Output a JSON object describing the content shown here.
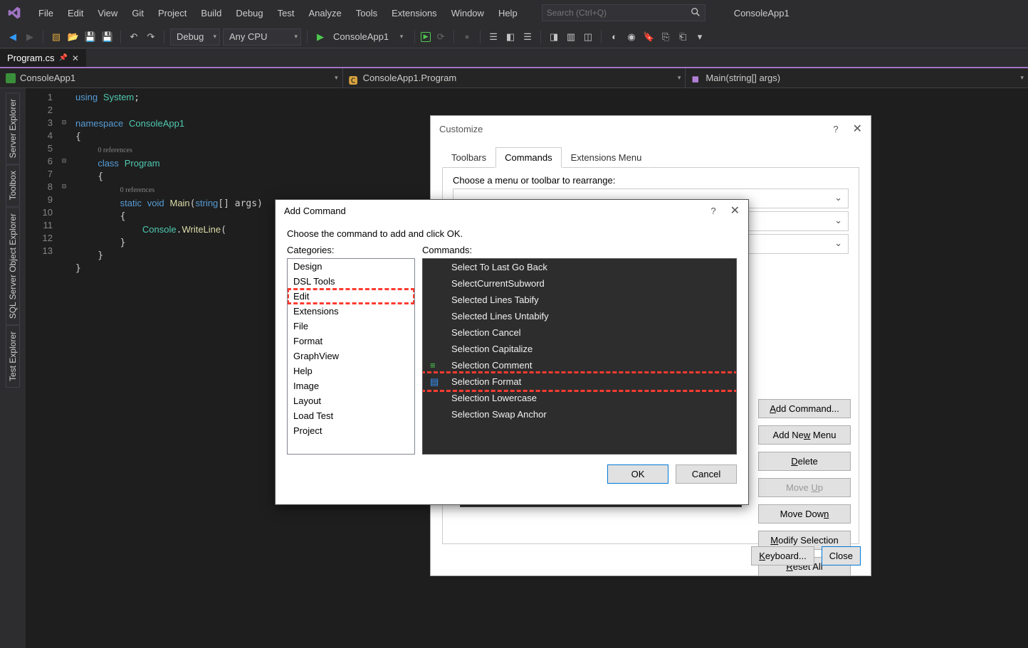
{
  "app": {
    "title": "ConsoleApp1"
  },
  "menu": [
    "File",
    "Edit",
    "View",
    "Git",
    "Project",
    "Build",
    "Debug",
    "Test",
    "Analyze",
    "Tools",
    "Extensions",
    "Window",
    "Help"
  ],
  "search": {
    "placeholder": "Search (Ctrl+Q)"
  },
  "toolbar": {
    "config": "Debug",
    "platform": "Any CPU",
    "target": "ConsoleApp1"
  },
  "tab": {
    "file": "Program.cs"
  },
  "nav": {
    "scope": "ConsoleApp1",
    "class": "ConsoleApp1.Program",
    "member": "Main(string[] args)"
  },
  "side_tabs": [
    "Server Explorer",
    "Toolbox",
    "SQL Server Object Explorer",
    "Test Explorer"
  ],
  "code": {
    "line_numbers": [
      "1",
      "2",
      "3",
      "4",
      "5",
      "6",
      "7",
      "8",
      "9",
      "10",
      "11",
      "12",
      "13"
    ],
    "lens1": "0 references",
    "lens2": "0 references"
  },
  "customize": {
    "title": "Customize",
    "tabs": {
      "toolbars": "Toolbars",
      "commands": "Commands",
      "exts": "Extensions Menu"
    },
    "choose_label": "Choose a menu or toolbar to rearrange:",
    "buttons": {
      "add_cmd": "Add Command...",
      "add_menu": "Add New Menu",
      "delete": "Delete",
      "move_up": "Move Up",
      "move_down": "Move Down",
      "modify": "Modify Selection",
      "reset": "Reset All"
    },
    "bottom": {
      "keyboard": "Keyboard...",
      "close": "Close"
    }
  },
  "addcmd": {
    "title": "Add Command",
    "prompt": "Choose the command to add and click OK.",
    "cat_label": "Categories:",
    "cmd_label": "Commands:",
    "categories": [
      "Design",
      "DSL Tools",
      "Edit",
      "Extensions",
      "File",
      "Format",
      "GraphView",
      "Help",
      "Image",
      "Layout",
      "Load Test",
      "Project"
    ],
    "cat_highlight": "Edit",
    "commands": [
      "Select To Last Go Back",
      "SelectCurrentSubword",
      "Selected Lines Tabify",
      "Selected Lines Untabify",
      "Selection Cancel",
      "Selection Capitalize",
      "Selection Comment",
      "Selection Format",
      "Selection Lowercase",
      "Selection Swap Anchor"
    ],
    "cmd_highlight": "Selection Format",
    "ok": "OK",
    "cancel": "Cancel"
  }
}
